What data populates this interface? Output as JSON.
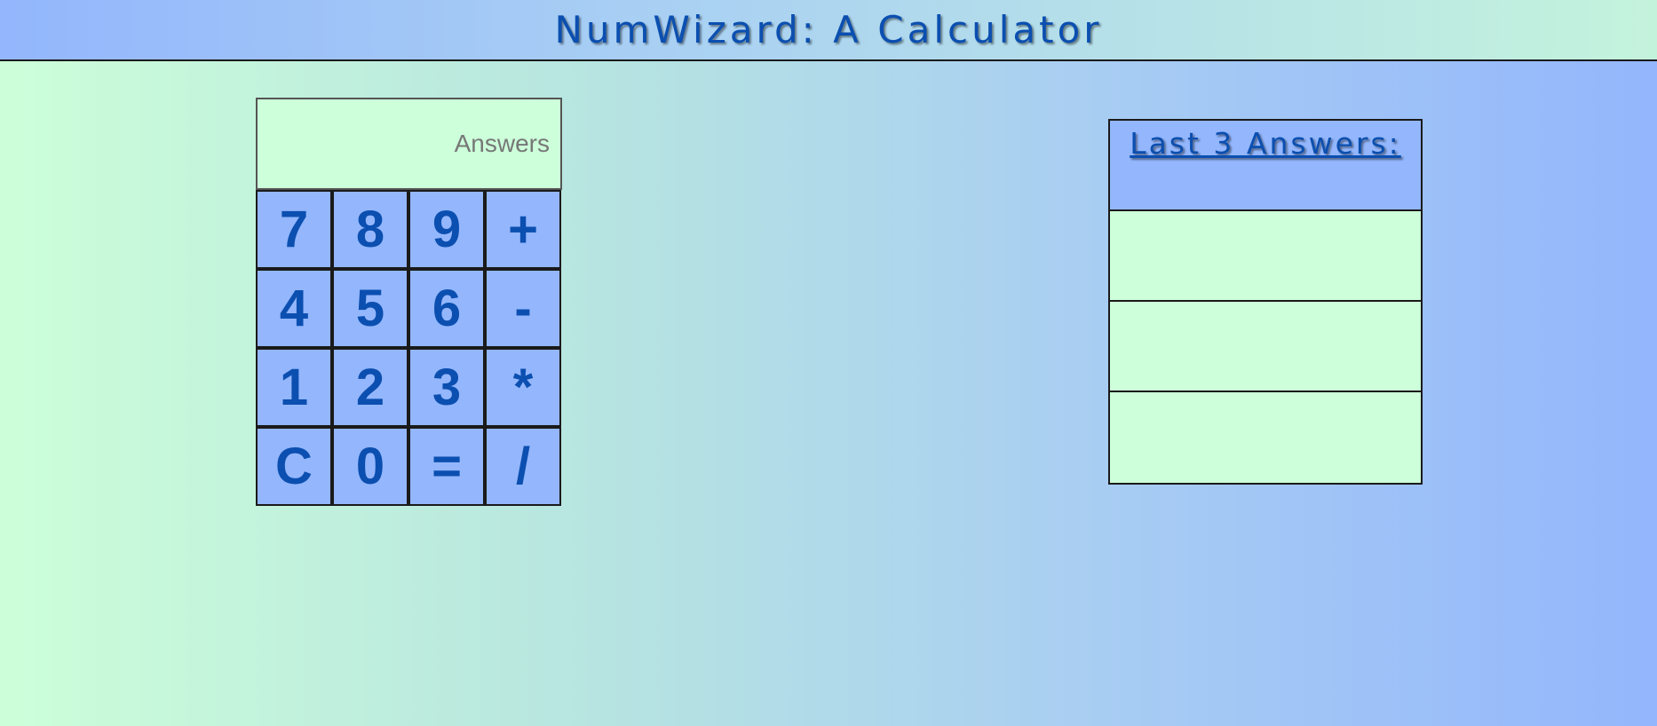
{
  "header": {
    "title": "NumWizard: A Calculator"
  },
  "calculator": {
    "display_placeholder": "Answers",
    "display_value": "",
    "keys": [
      {
        "label": "7"
      },
      {
        "label": "8"
      },
      {
        "label": "9"
      },
      {
        "label": "+"
      },
      {
        "label": "4"
      },
      {
        "label": "5"
      },
      {
        "label": "6"
      },
      {
        "label": "-"
      },
      {
        "label": "1"
      },
      {
        "label": "2"
      },
      {
        "label": "3"
      },
      {
        "label": "*"
      },
      {
        "label": "C"
      },
      {
        "label": "0"
      },
      {
        "label": "="
      },
      {
        "label": "/"
      }
    ]
  },
  "history": {
    "title": "Last 3 Answers:",
    "answers": [
      "",
      "",
      ""
    ]
  },
  "colors": {
    "key_background": "#93b6fc",
    "key_text": "#0b4fb0",
    "display_background": "#ccffda",
    "title_text": "#0b4fb0"
  }
}
